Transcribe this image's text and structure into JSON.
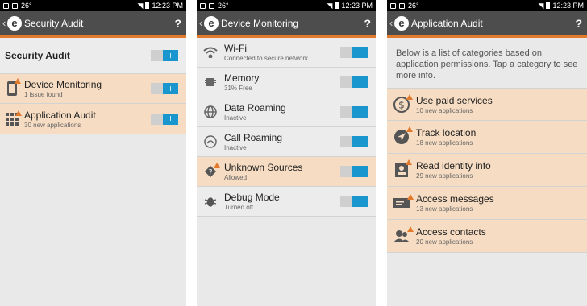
{
  "status_bar": {
    "temp": "26°",
    "time": "12:23 PM"
  },
  "panel1": {
    "title": "Security Audit",
    "help": "?",
    "header_row": {
      "label": "Security Audit",
      "toggle": "I"
    },
    "rows": [
      {
        "label": "Device Monitoring",
        "sub": "1 issue found",
        "toggle": "I",
        "icon": "phone-warning-icon"
      },
      {
        "label": "Application Audit",
        "sub": "30 new applications",
        "toggle": "I",
        "icon": "apps-grid-warning-icon"
      }
    ]
  },
  "panel2": {
    "title": "Device Monitoring",
    "help": "?",
    "rows": [
      {
        "label": "Wi-Fi",
        "sub": "Connected to secure network",
        "toggle": "I",
        "icon": "wifi-icon"
      },
      {
        "label": "Memory",
        "sub": "31% Free",
        "toggle": "I",
        "icon": "chip-icon"
      },
      {
        "label": "Data Roaming",
        "sub": "Inactive",
        "toggle": "I",
        "icon": "globe-icon"
      },
      {
        "label": "Call Roaming",
        "sub": "Inactive",
        "toggle": "I",
        "icon": "phone-globe-icon"
      },
      {
        "label": "Unknown Sources",
        "sub": "Allowed",
        "toggle": "I",
        "icon": "unknown-source-warning-icon"
      },
      {
        "label": "Debug Mode",
        "sub": "Turned off",
        "toggle": "I",
        "icon": "bug-icon"
      }
    ]
  },
  "panel3": {
    "title": "Application Audit",
    "help": "?",
    "intro": "Below is a list of categories based on application permissions. Tap a category to see more info.",
    "rows": [
      {
        "label": "Use paid services",
        "sub": "10 new applications",
        "icon": "dollar-warning-icon"
      },
      {
        "label": "Track location",
        "sub": "18 new applications",
        "icon": "location-arrow-warning-icon"
      },
      {
        "label": "Read identity info",
        "sub": "29 new applications",
        "icon": "id-card-warning-icon"
      },
      {
        "label": "Access messages",
        "sub": "13 new applications",
        "icon": "message-warning-icon"
      },
      {
        "label": "Access contacts",
        "sub": "20 new applications",
        "icon": "contacts-warning-icon"
      }
    ]
  },
  "colors": {
    "accent": "#e27a2c",
    "toggle_on": "#1a96cf",
    "warn_row": "#f6dcc2",
    "appbar": "#4d4d4d"
  }
}
